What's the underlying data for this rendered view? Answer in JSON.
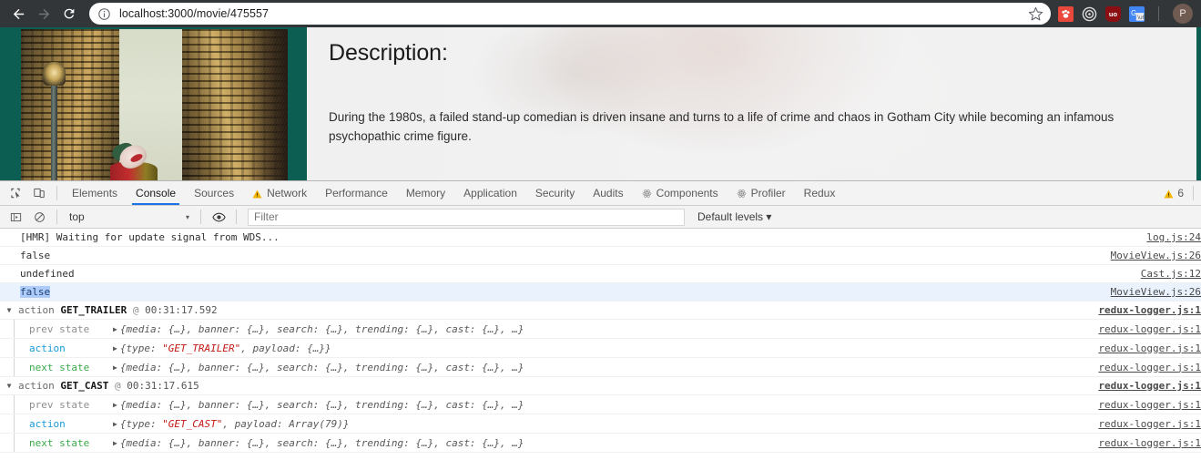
{
  "browser": {
    "back_label": "Back",
    "forward_label": "Forward",
    "reload_label": "Reload",
    "url": "localhost:3000/movie/475557",
    "site_info_icon": "info-circle-icon",
    "bookmark_icon": "star-icon",
    "extensions": [
      {
        "name": "paw-extension-icon",
        "glyph": "♟"
      },
      {
        "name": "target-extension-icon",
        "glyph": "◎"
      },
      {
        "name": "ublock-origin-icon",
        "glyph": "uo"
      },
      {
        "name": "google-translate-icon",
        "glyph": "G"
      }
    ],
    "profile_initial": "P"
  },
  "page": {
    "description_heading": "Description:",
    "description_text": "During the 1980s, a failed stand-up comedian is driven insane and turns to a life of crime and chaos in Gotham City while becoming an infamous psychopathic crime figure.",
    "background_color": "#0c5e53",
    "panel_color": "#f1f1f1"
  },
  "devtools": {
    "inspect_icon": "inspect-element-icon",
    "device_icon": "device-toolbar-icon",
    "tabs": [
      {
        "label": "Elements",
        "icon": null,
        "active": false
      },
      {
        "label": "Console",
        "icon": null,
        "active": true
      },
      {
        "label": "Sources",
        "icon": null,
        "active": false
      },
      {
        "label": "Network",
        "icon": "warning-triangle-icon",
        "active": false
      },
      {
        "label": "Performance",
        "icon": null,
        "active": false
      },
      {
        "label": "Memory",
        "icon": null,
        "active": false
      },
      {
        "label": "Application",
        "icon": null,
        "active": false
      },
      {
        "label": "Security",
        "icon": null,
        "active": false
      },
      {
        "label": "Audits",
        "icon": null,
        "active": false
      },
      {
        "label": "Components",
        "icon": "react-atom-icon",
        "active": false
      },
      {
        "label": "Profiler",
        "icon": "react-atom-icon",
        "active": false
      },
      {
        "label": "Redux",
        "icon": null,
        "active": false
      }
    ],
    "warning_count": "6",
    "warning_icon": "warning-triangle-icon",
    "toolbar": {
      "sidebar_icon": "console-sidebar-icon",
      "clear_icon": "clear-console-icon",
      "context": "top",
      "context_caret": "▾",
      "eye_icon": "live-expression-eye-icon",
      "filter_placeholder": "Filter",
      "filter_value": "",
      "levels_label": "Default levels",
      "levels_caret": "▾"
    },
    "console": {
      "simple_rows": [
        {
          "text": "[HMR] Waiting for update signal from WDS...",
          "kind": "plain",
          "source": "log.js:24",
          "selected": false
        },
        {
          "text": "false",
          "kind": "bool",
          "source": "MovieView.js:26",
          "selected": false
        },
        {
          "text": "undefined",
          "kind": "undef",
          "source": "Cast.js:12",
          "selected": false
        },
        {
          "text": "false",
          "kind": "bool-selected",
          "source": "MovieView.js:26",
          "selected": true
        }
      ],
      "groups": [
        {
          "triangle": "▼",
          "prefix": "action",
          "type": "GET_TRAILER",
          "at": "@",
          "time": "00:31:17.592",
          "source": "redux-logger.js:1",
          "rows": [
            {
              "label": "prev state",
              "label_kind": "prev",
              "triangle": "▶",
              "preview": "{media: {…}, banner: {…}, search: {…}, trending: {…}, cast: {…}, …}",
              "source": "redux-logger.js:1"
            },
            {
              "label": "action",
              "label_kind": "action",
              "triangle": "▶",
              "preview_pre": "{type: ",
              "preview_str": "\"GET_TRAILER\"",
              "preview_post": ", payload: {…}}",
              "source": "redux-logger.js:1"
            },
            {
              "label": "next state",
              "label_kind": "next",
              "triangle": "▶",
              "preview": "{media: {…}, banner: {…}, search: {…}, trending: {…}, cast: {…}, …}",
              "source": "redux-logger.js:1"
            }
          ]
        },
        {
          "triangle": "▼",
          "prefix": "action",
          "type": "GET_CAST",
          "at": "@",
          "time": "00:31:17.615",
          "source": "redux-logger.js:1",
          "rows": [
            {
              "label": "prev state",
              "label_kind": "prev",
              "triangle": "▶",
              "preview": "{media: {…}, banner: {…}, search: {…}, trending: {…}, cast: {…}, …}",
              "source": "redux-logger.js:1"
            },
            {
              "label": "action",
              "label_kind": "action",
              "triangle": "▶",
              "preview_pre": "{type: ",
              "preview_str": "\"GET_CAST\"",
              "preview_post": ", payload: Array(79)}",
              "source": "redux-logger.js:1"
            },
            {
              "label": "next state",
              "label_kind": "next",
              "triangle": "▶",
              "preview": "{media: {…}, banner: {…}, search: {…}, trending: {…}, cast: {…}, …}",
              "source": "redux-logger.js:1"
            }
          ]
        }
      ]
    }
  }
}
